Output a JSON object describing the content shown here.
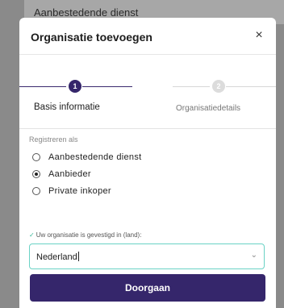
{
  "backdrop": {
    "text": "Aanbestedende dienst"
  },
  "modal": {
    "title": "Organisatie toevoegen",
    "close_symbol": "×"
  },
  "stepper": {
    "steps": [
      {
        "number": "1",
        "label": "Basis informatie",
        "state": "active"
      },
      {
        "number": "2",
        "label": "Organisatiedetails",
        "state": "inactive"
      }
    ]
  },
  "register": {
    "label": "Registreren als",
    "options": [
      {
        "label": "Aanbestedende dienst",
        "checked": false
      },
      {
        "label": "Aanbieder",
        "checked": true
      },
      {
        "label": "Private inkoper",
        "checked": false
      }
    ]
  },
  "country": {
    "label": "Uw organisatie is gevestigd in (land):",
    "value": "Nederland",
    "chevron": "⌄"
  },
  "footer": {
    "primary_label": "Doorgaan"
  },
  "colors": {
    "primary": "#35266b",
    "focus_border": "#6ad2c5",
    "check": "#3ab89a"
  }
}
